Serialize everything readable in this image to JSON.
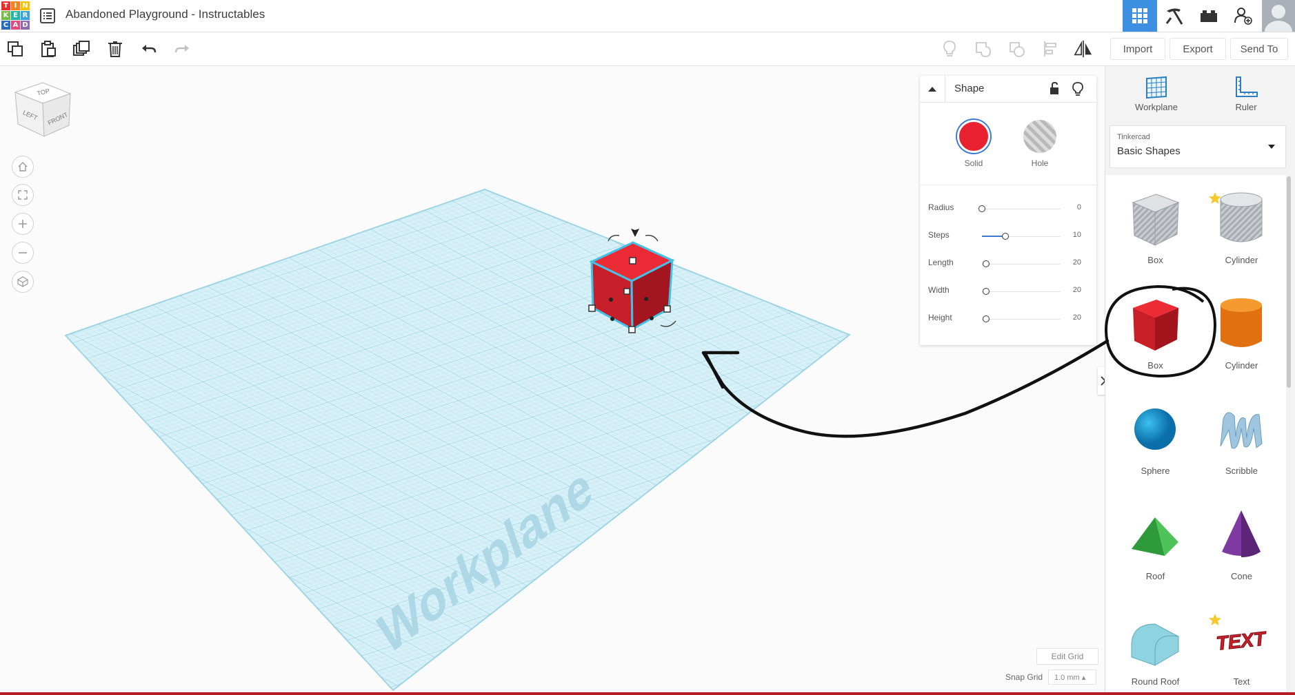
{
  "app": {
    "logo_letters": [
      "T",
      "I",
      "N",
      "K",
      "E",
      "R",
      "C",
      "A",
      "D"
    ],
    "logo_colors": [
      "#e8312d",
      "#f58220",
      "#f8c100",
      "#6fbf44",
      "#1fb5ad",
      "#38a4dd",
      "#2a6ebb",
      "#e34a7d",
      "#8c6bb1"
    ],
    "document_title": "Abandoned Playground - Instructables"
  },
  "toolbar": {
    "import_label": "Import",
    "export_label": "Export",
    "send_to_label": "Send To"
  },
  "workplane": {
    "watermark": "Workplane",
    "edit_grid_label": "Edit Grid",
    "snap_grid_label": "Snap Grid",
    "snap_grid_value": "1.0 mm ▴"
  },
  "viewcube": {
    "top": "TOP",
    "left": "LEFT",
    "front": "FRONT"
  },
  "inspector": {
    "title": "Shape",
    "solid_label": "Solid",
    "hole_label": "Hole",
    "solid_color": "#e8202f",
    "props": [
      {
        "label": "Radius",
        "value": "0",
        "fraction": 0.0
      },
      {
        "label": "Steps",
        "value": "10",
        "fraction": 0.3
      },
      {
        "label": "Length",
        "value": "20",
        "fraction": 0.05
      },
      {
        "label": "Width",
        "value": "20",
        "fraction": 0.05
      },
      {
        "label": "Height",
        "value": "20",
        "fraction": 0.05
      }
    ]
  },
  "panel": {
    "workplane_label": "Workplane",
    "ruler_label": "Ruler",
    "library_small": "Tinkercad",
    "library_name": "Basic Shapes",
    "shapes": [
      {
        "name": "Box",
        "icon": "box-hole-icon",
        "starred": true
      },
      {
        "name": "Cylinder",
        "icon": "cylinder-hole-icon",
        "starred": true
      },
      {
        "name": "Box",
        "icon": "box-solid-icon",
        "starred": false
      },
      {
        "name": "Cylinder",
        "icon": "cylinder-solid-icon",
        "starred": false
      },
      {
        "name": "Sphere",
        "icon": "sphere-icon",
        "starred": false
      },
      {
        "name": "Scribble",
        "icon": "scribble-icon",
        "starred": false
      },
      {
        "name": "Roof",
        "icon": "roof-icon",
        "starred": false
      },
      {
        "name": "Cone",
        "icon": "cone-icon",
        "starred": false
      },
      {
        "name": "Round Roof",
        "icon": "round-roof-icon",
        "starred": true
      },
      {
        "name": "Text",
        "icon": "text-shape-icon",
        "starred": true
      }
    ]
  }
}
